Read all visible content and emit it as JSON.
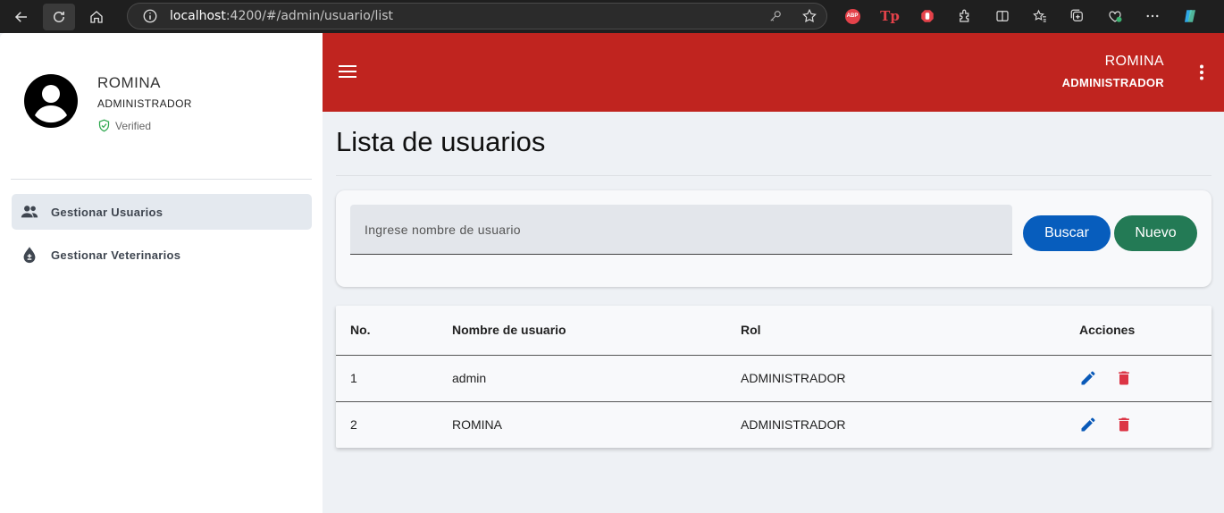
{
  "browser": {
    "url_host": "localhost",
    "url_rest": ":4200/#/admin/usuario/list",
    "ext_abp": "ABP",
    "ext_tp": "Tp"
  },
  "sidebar": {
    "profile_name": "ROMINA",
    "profile_role": "ADMINISTRADOR",
    "verified": "Verified",
    "items": [
      {
        "label": "Gestionar Usuarios",
        "icon": "people-icon",
        "active": true
      },
      {
        "label": "Gestionar Veterinarios",
        "icon": "drop-plus-minus-icon",
        "active": false
      }
    ]
  },
  "toolbar": {
    "user_name": "ROMINA",
    "user_role": "ADMINISTRADOR"
  },
  "main": {
    "title": "Lista de usuarios",
    "search_placeholder": "Ingrese nombre de usuario",
    "search_button": "Buscar",
    "new_button": "Nuevo"
  },
  "table": {
    "headers": [
      "No.",
      "Nombre de usuario",
      "Rol",
      "Acciones"
    ],
    "rows": [
      {
        "no": "1",
        "username": "admin",
        "role": "ADMINISTRADOR"
      },
      {
        "no": "2",
        "username": "ROMINA",
        "role": "ADMINISTRADOR"
      }
    ]
  },
  "colors": {
    "toolbar": "#c0241f",
    "buscar": "#075dbd",
    "nuevo": "#237a55",
    "edit_icon": "#0a5ab8",
    "delete_icon": "#dc3545"
  }
}
